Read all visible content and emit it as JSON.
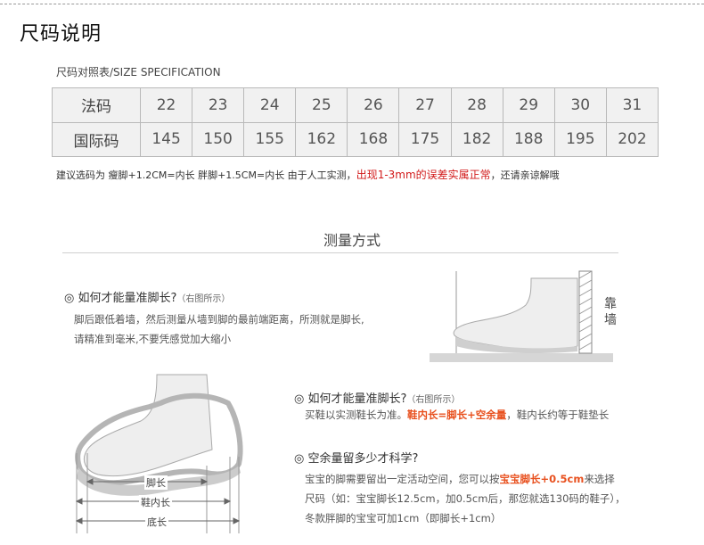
{
  "page_title": "尺码说明",
  "table_caption": "尺码对照表/SIZE SPECIFICATION",
  "table": {
    "rows": [
      {
        "label": "法码",
        "values": [
          "22",
          "23",
          "24",
          "25",
          "26",
          "27",
          "28",
          "29",
          "30",
          "31"
        ]
      },
      {
        "label": "国际码",
        "values": [
          "145",
          "150",
          "155",
          "162",
          "168",
          "175",
          "182",
          "188",
          "195",
          "202"
        ]
      }
    ]
  },
  "note": {
    "text": "建议选码为 瘦脚+1.2CM=内长 胖脚+1.5CM=内长  由于人工实测，",
    "highlight": "出现1-3mm的误差实属正常",
    "tail": "，还请亲谅解哦"
  },
  "measure": {
    "title": "测量方式",
    "wall_label": "靠墙",
    "q1": {
      "title": "◎ 如何才能量准脚长?",
      "sub": "（右图所示）",
      "lines": [
        "脚后跟低着墙，然后测量从墙到脚的最前端距离，所测就是脚长,",
        "请精准到毫米,不要凭感觉加大缩小"
      ]
    },
    "q2": {
      "title": "◎ 如何才能量准脚长?",
      "sub": "（右图所示）",
      "pre": "买鞋以实测鞋长为准。",
      "highlight": "鞋内长=脚长+空余量",
      "post": "，鞋内长约等于鞋垫长"
    },
    "q3": {
      "title": "◎ 空余量留多少才科学?",
      "line1_pre": "宝宝的脚需要留出一定活动空间，您可以按",
      "line1_hl": "宝宝脚长+0.5cm",
      "line1_post": "来选择",
      "line2": "尺码（如：宝宝脚长12.5cm，加0.5cm后，那您就选130码的鞋子），",
      "line3": "冬款胖脚的宝宝可加1cm（即脚长+1cm）"
    },
    "dims": {
      "foot": "脚长",
      "inner": "鞋内长",
      "sole": "底长"
    }
  }
}
